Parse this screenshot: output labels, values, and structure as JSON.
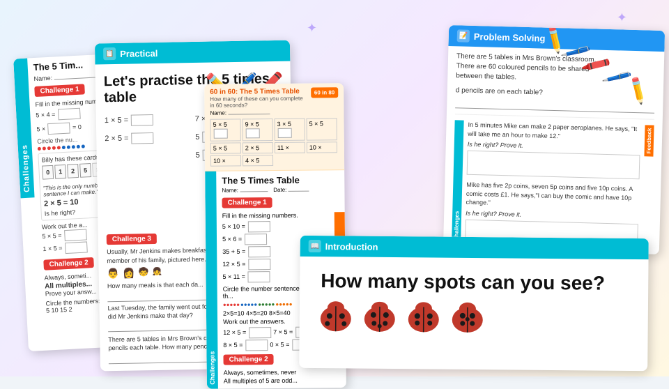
{
  "scene": {
    "background": "#f0f4f8"
  },
  "cards": {
    "challenges_left": {
      "title": "The 5 Tim...",
      "header": "Challenges",
      "challenge1_label": "Challenge 1",
      "challenge1_text": "Fill in the missing numb...",
      "eq1": "5 × 4 =",
      "eq2": "5 × __ = 0",
      "circle_text": "Circle the nu...",
      "billy_text": "Billy has these cards.",
      "cards_display": "0  1  2  5  x  =",
      "says": "He says, \"This is the only number sentence I can make.\"",
      "equation": "2 × 5 = 10",
      "is_he_right": "Is he right?",
      "work_out": "Work out the a...",
      "eq3": "5 × 5 =",
      "eq4": "1 × 5 =",
      "challenge2_label": "Challenge 2",
      "challenge2_text": "Always, someti...",
      "all_multiples": "All multiples...",
      "prove_answer": "Prove your answ...",
      "circle_numbers": "Circle the numbers:",
      "numbers": "5  10  15  2"
    },
    "practical": {
      "header_label": "Practical",
      "title": "Let's practise the 5 times table",
      "eq1": "1 × 5 =",
      "eq2": "2 × 5 =",
      "eq3": "7 × 5",
      "eq4": "5",
      "eq5": "5",
      "challenge3_label": "Challenge 3",
      "challenge3_text": "Usually, Mr Jenkins makes breakfast, lunch and dinner for each member of his family, pictured here.",
      "meals_text": "How many meals is that each da...",
      "last_tuesday": "Last Tuesday, the family went ou for lunch. How many meals did M Jenkins make that day?",
      "tables_text": "There are 5 tables in Mrs Brown classroom. She wants 5 pencils each table. How many pencils she need?"
    },
    "problem_solving": {
      "header_label": "Problem Solving",
      "text": "There are 5 tables in Mrs Brown's classroom. There are  60 coloured pencils to be shared between the tables.",
      "question": "d pencils are on each table?",
      "mike_text": "In 5 minutes Mike can make 2 paper aeroplanes. He says, \"It will take me an hour to make 12.\"",
      "is_right": "Is he right? Prove it.",
      "mike2_text": "Mike has five 2p coins, seven 5p coins and five 10p coins. A comic costs £1. He says,\"I can buy the comic and have 10p change.\"",
      "is_right2": "Is he right? Prove it."
    },
    "times_table_worksheet": {
      "header_label": "Challenges",
      "title": "The 5 Times Table",
      "name_label": "Name:",
      "date_label": "Date:",
      "challenge1_label": "Challenge 1",
      "fill_text": "Fill in the missing numbers.",
      "eq1": "5 × 10 =",
      "eq2": "5 × 6 =",
      "eq3": "35 + 5 =",
      "eq4": "12 × 5 =",
      "eq5": "5 × 11 =",
      "circle_text": "Circle the number sentence that fits th...",
      "work_text": "Work out the answers.",
      "eq6": "12 × 5 =",
      "eq7": "7 × 5 =",
      "eq8": "8 × 5 =",
      "eq9": "0 × 5 =",
      "challenge2_label": "Challenge 2",
      "challenge2_text": "Always, sometimes, never",
      "challenge2_sub": "All multiples of 5 are odd..."
    },
    "sixty_in_sixty": {
      "title": "60 in 60: The 5 Times Table",
      "subtitle": "How many of these can you complete in 60 seconds?",
      "name_label": "Name:",
      "cells": [
        "5×5",
        "9×5",
        "3×5",
        "5×5",
        "2×5",
        "11×5",
        "10×5",
        "4×5"
      ],
      "label": "60 in 80"
    },
    "introduction": {
      "header_label": "Introduction",
      "title": "How many spots can you see?"
    }
  },
  "sparkles": [
    "✦",
    "✦",
    "✦",
    "✦",
    "✦",
    "✦"
  ]
}
